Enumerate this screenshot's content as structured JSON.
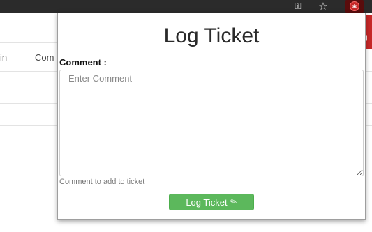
{
  "toolbar": {
    "icons": [
      "key-icon",
      "star-icon",
      "extension-icon"
    ]
  },
  "background_page": {
    "header_red_text": "r\ng",
    "nav_items": [
      "in",
      "Com"
    ]
  },
  "popup": {
    "title": "Log Ticket",
    "comment_label": "Comment :",
    "comment_placeholder": "Enter Comment",
    "comment_value": "",
    "help_text": "Comment to add to ticket",
    "submit_label": "Log Ticket",
    "submit_icon": "ticket-icon",
    "submit_color": "#5cb85c"
  }
}
